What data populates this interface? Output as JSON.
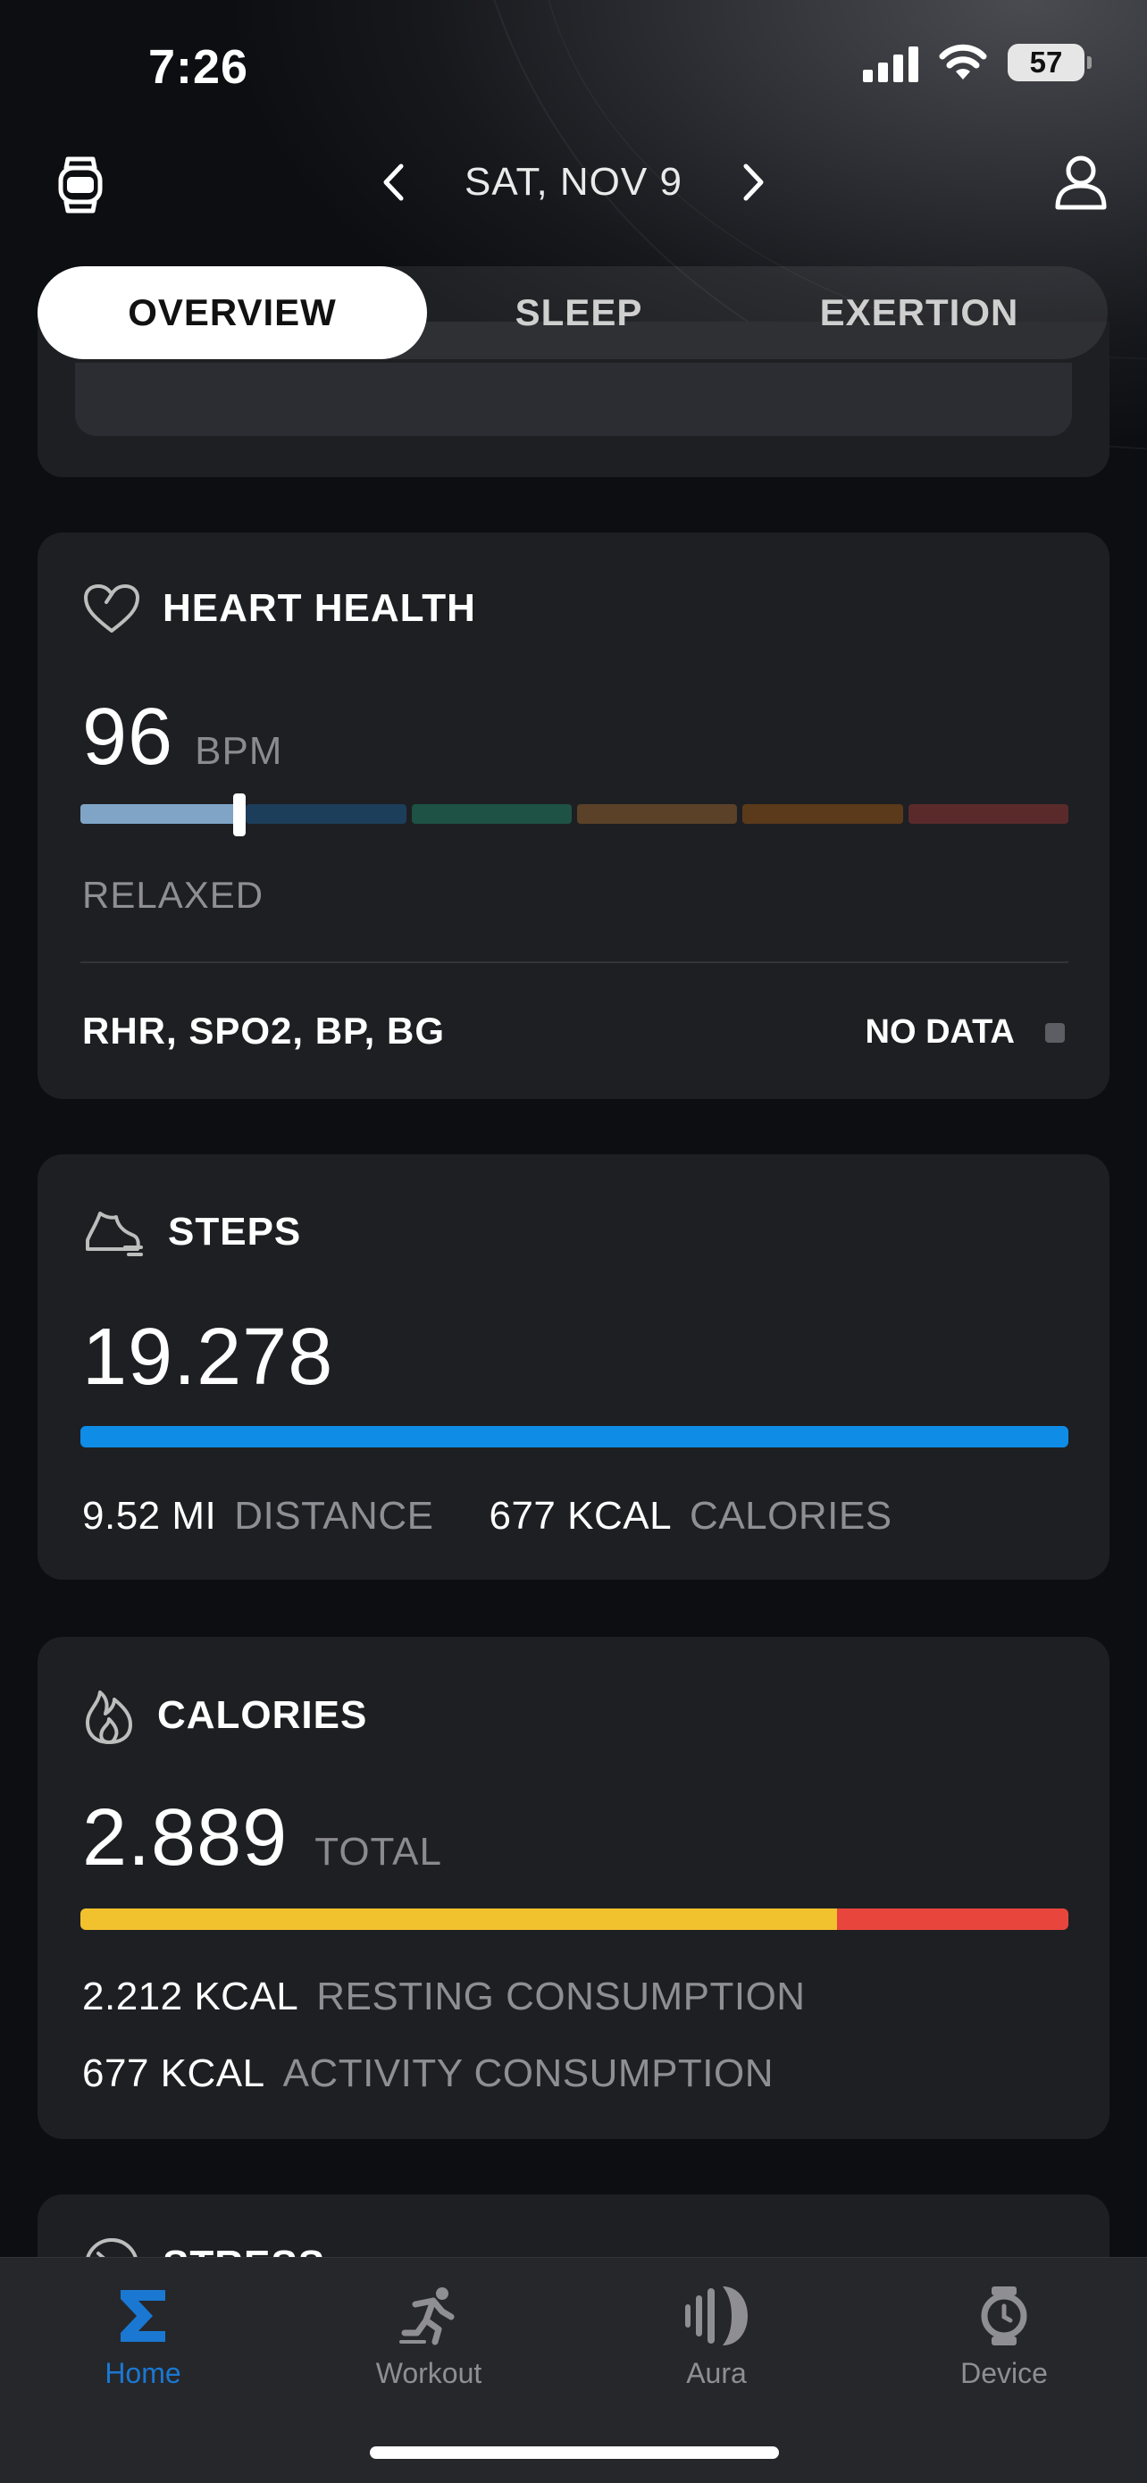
{
  "status_bar": {
    "time": "7:26",
    "battery": "57"
  },
  "header": {
    "date": "SAT, NOV 9"
  },
  "tabs": [
    {
      "label": "OVERVIEW",
      "active": true
    },
    {
      "label": "SLEEP",
      "active": false
    },
    {
      "label": "EXERTION",
      "active": false
    }
  ],
  "heart": {
    "title": "HEART HEALTH",
    "value": "96",
    "unit": "BPM",
    "zone": "RELAXED",
    "zone_colors": [
      "#7fa4c6",
      "#1d3e5a",
      "#1d5244",
      "#5a4128",
      "#5a3a1a",
      "#5a2a2a"
    ],
    "marker_fraction": 0.155,
    "metrics_label": "RHR, SPO2, BP, BG",
    "metrics_status": "NO DATA"
  },
  "steps": {
    "title": "STEPS",
    "value": "19.278",
    "bar_color": "#0f8ce6",
    "distance_value": "9.52 MI",
    "distance_label": "DISTANCE",
    "calories_value": "677 KCAL",
    "calories_label": "CALORIES"
  },
  "calories": {
    "title": "CALORIES",
    "value": "2.889",
    "unit": "TOTAL",
    "resting_fraction": 0.766,
    "resting_color": "#f2c12e",
    "activity_color": "#e8453c",
    "resting_value": "2.212 KCAL",
    "resting_label": "RESTING CONSUMPTION",
    "activity_value": "677 KCAL",
    "activity_label": "ACTIVITY CONSUMPTION"
  },
  "stress": {
    "title": "STRESS"
  },
  "nav": [
    {
      "label": "Home",
      "icon": "sigma-icon",
      "active": true
    },
    {
      "label": "Workout",
      "icon": "runner-icon",
      "active": false
    },
    {
      "label": "Aura",
      "icon": "aura-icon",
      "active": false
    },
    {
      "label": "Device",
      "icon": "watch-icon",
      "active": false
    }
  ]
}
